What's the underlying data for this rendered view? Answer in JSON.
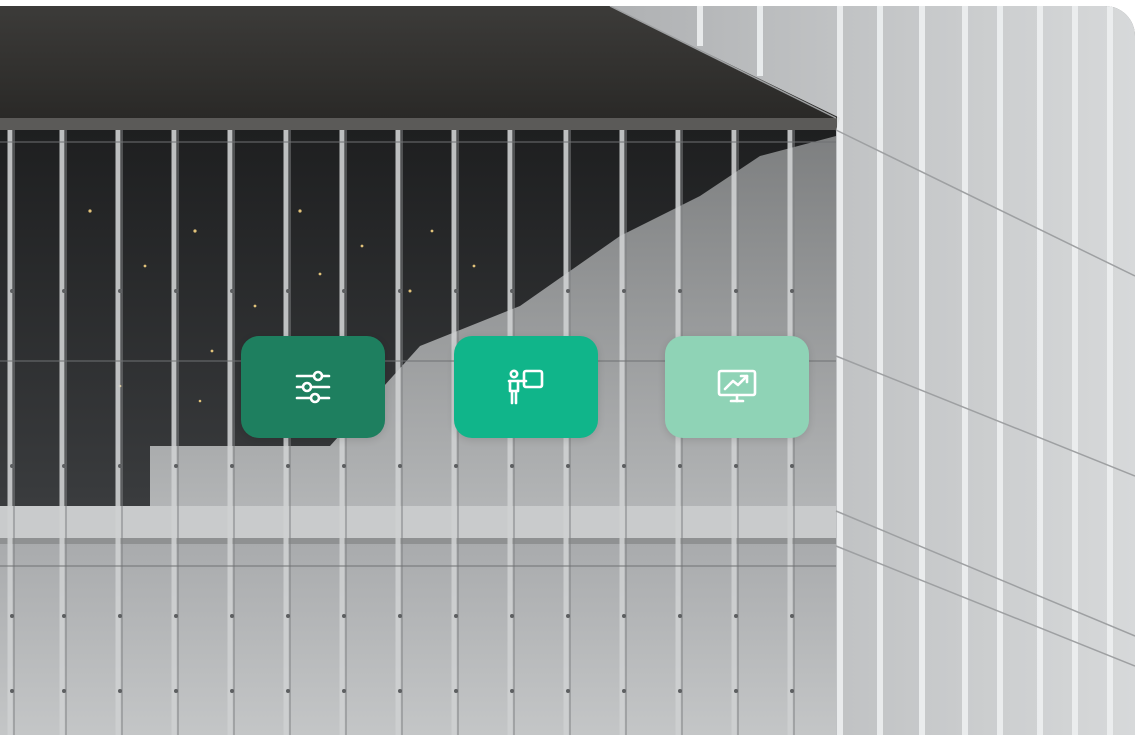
{
  "hero": {
    "image": "building-glass-facade-photo"
  },
  "feature_tiles": [
    {
      "icon": "sliders-icon",
      "color": "#1e7f5f"
    },
    {
      "icon": "presentation-icon",
      "color": "#10b58a"
    },
    {
      "icon": "analytics-monitor-icon",
      "color": "#8fd3b6"
    }
  ]
}
